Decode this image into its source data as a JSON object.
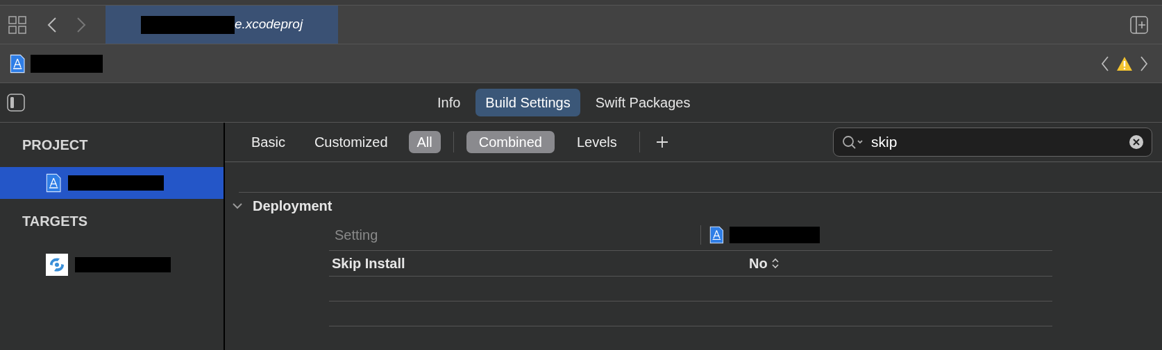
{
  "tab": {
    "title": "e.xcodeproj",
    "selected": true
  },
  "editor_tabs": [
    {
      "label": "Info",
      "selected": false
    },
    {
      "label": "Build Settings",
      "selected": true
    },
    {
      "label": "Swift Packages",
      "selected": false
    }
  ],
  "sidebar": [
    {
      "title": "PROJECT",
      "items": [
        {
          "kind": "project",
          "selected": true
        }
      ]
    },
    {
      "title": "TARGETS",
      "items": [
        {
          "kind": "app",
          "selected": false
        }
      ]
    }
  ],
  "filters": [
    {
      "label": "Basic",
      "selected": false
    },
    {
      "label": "Customized",
      "selected": false
    },
    {
      "label": "All",
      "selected": true
    }
  ],
  "views": [
    {
      "label": "Combined",
      "selected": true
    },
    {
      "label": "Levels",
      "selected": false
    }
  ],
  "search": {
    "value": "skip"
  },
  "group": {
    "title": "Deployment",
    "expanded": true,
    "header": "Setting",
    "rows": [
      {
        "name": "Skip Install",
        "value": "No"
      }
    ]
  }
}
